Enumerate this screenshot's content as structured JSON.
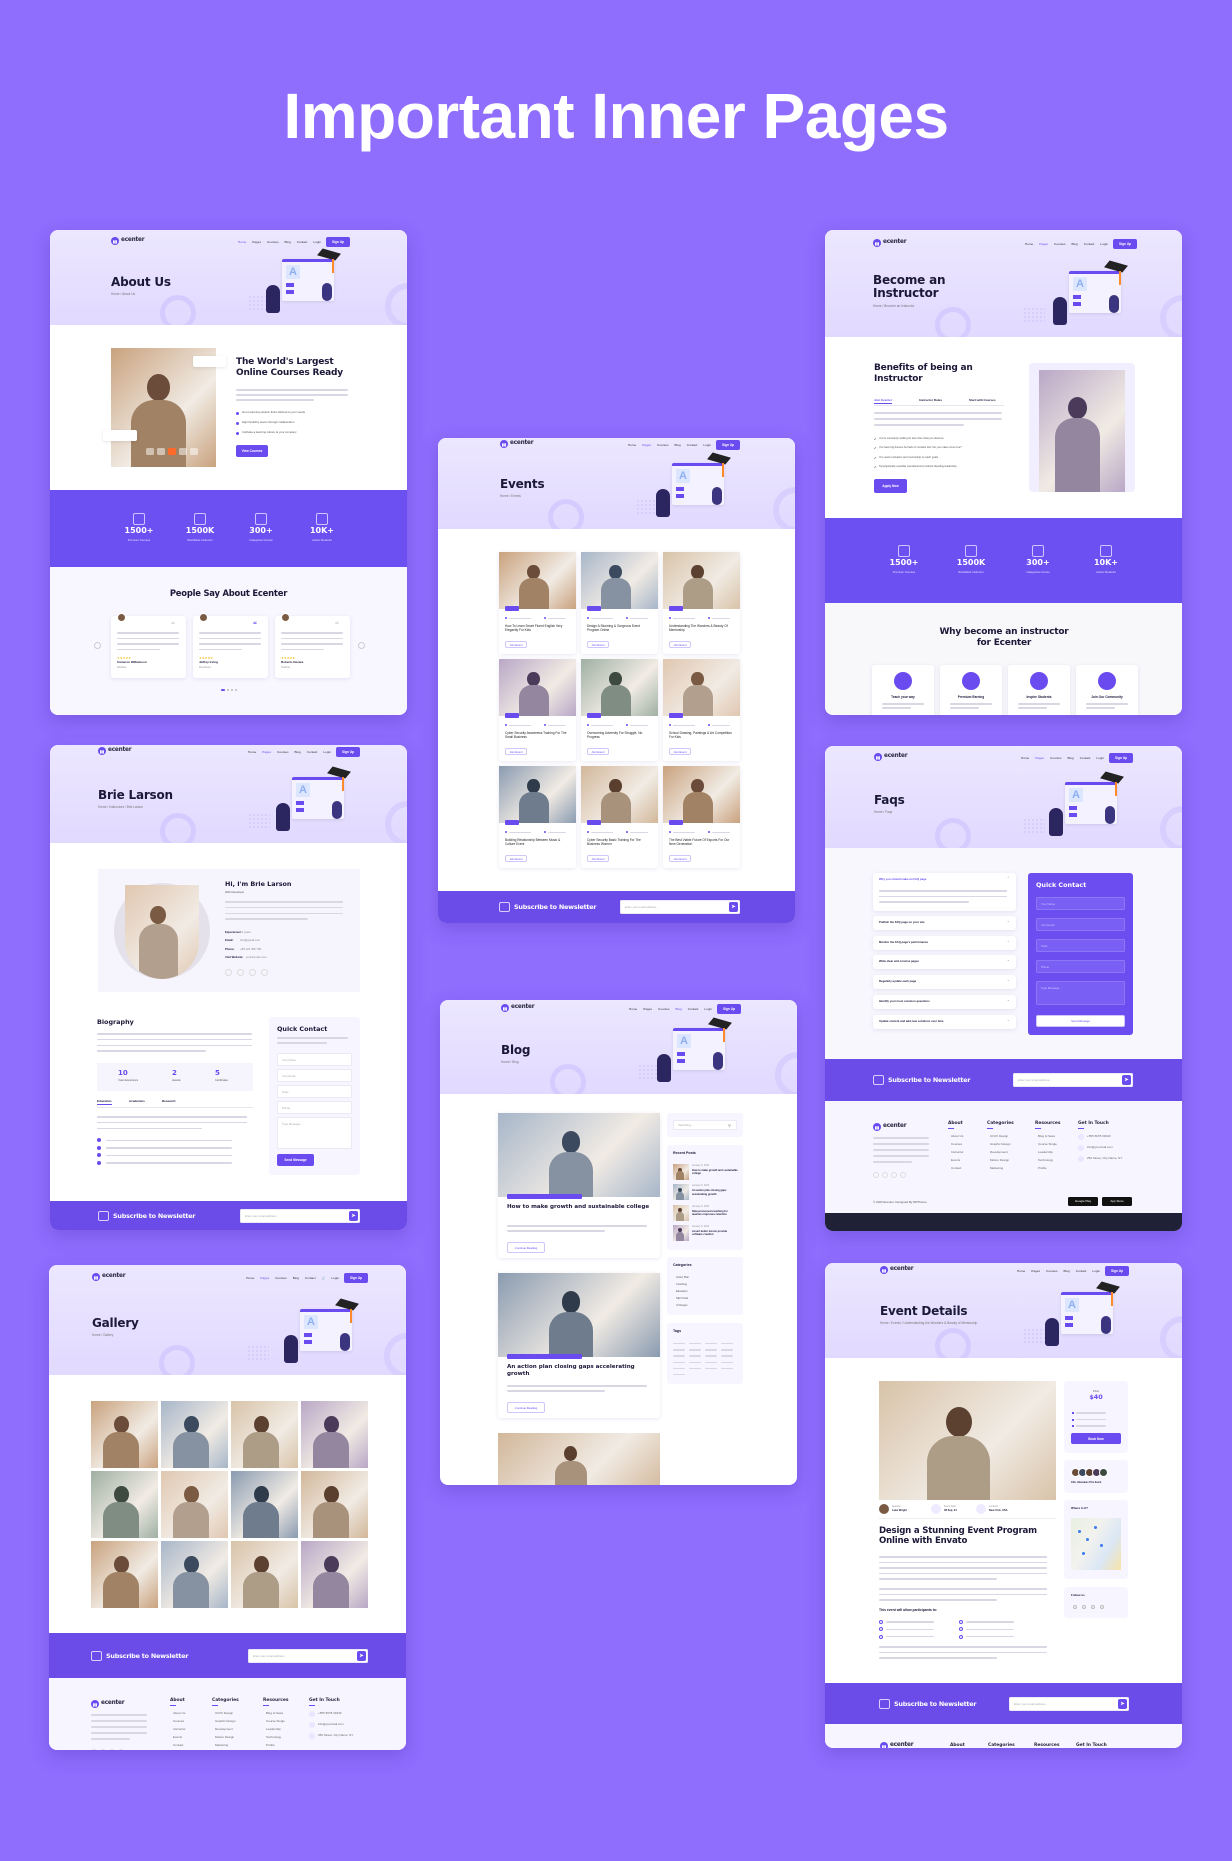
{
  "headline": "Important Inner Pages",
  "colors": {
    "background": "#8f6dfd",
    "primary": "#6a4bf0",
    "hero": "#e6e0ff",
    "dark_footer": "#1f2236",
    "accent_orange": "#ff6a2b"
  },
  "brand": {
    "name": "ecenter",
    "logo_icon": "book-icon"
  },
  "nav": {
    "items": [
      "Home",
      "Pages",
      "Courses",
      "Blog",
      "Contact"
    ],
    "login": "Login",
    "signup": "Sign Up"
  },
  "newsletter": {
    "title": "Subscribe to Newsletter",
    "placeholder": "Enter your email address...",
    "icon": "envelope-icon",
    "send_icon": "send-icon"
  },
  "stats": [
    {
      "value": "1500+",
      "label": "Premium Courses",
      "icon": "courses-icon"
    },
    {
      "value": "1500K",
      "label": "Worldwide Instructor",
      "icon": "instructor-icon"
    },
    {
      "value": "300+",
      "label": "Categories Course",
      "icon": "list-icon"
    },
    {
      "value": "10K+",
      "label": "Active Students",
      "icon": "user-icon"
    }
  ],
  "footer": {
    "columns": [
      {
        "title": "About",
        "items": [
          "About Us",
          "Courses",
          "Instructor",
          "Events",
          "Contact"
        ]
      },
      {
        "title": "Categories",
        "items": [
          "UI/UX Design",
          "Graphic Design",
          "Development",
          "Motion Design",
          "Marketing"
        ]
      },
      {
        "title": "Resources",
        "items": [
          "Blog & News",
          "Course Single",
          "Leadership",
          "Technology",
          "Profile"
        ]
      },
      {
        "title": "Get In Touch",
        "items": [
          "+555 5678 33340",
          "info@yourmail.com",
          "256 Street, City Name, NY"
        ]
      }
    ],
    "copyright": "© 2023 Ecenter. Designed By RRTheme",
    "apps": [
      "Google Play",
      "App Store"
    ]
  },
  "pages": {
    "about": {
      "title": "About Us",
      "crumb": "Home / About Us",
      "heading": "The World's Largest Online Courses Ready",
      "checks": [
        "Get a learning solution that's tailored to your needs",
        "High flexibility teams through collaboration",
        "Cultivate a learning culture at your company"
      ],
      "button": "View Courses",
      "testimonials_title": "People Say About Ecenter",
      "testimonials": [
        {
          "name": "Cameron Williamson",
          "role": "Website"
        },
        {
          "name": "Jeffrey Irving",
          "role": "Developer"
        },
        {
          "name": "Roberto Devara",
          "role": "Teacher"
        }
      ]
    },
    "instructor": {
      "title": "Become an Instructor",
      "crumb": "Home / Become an Instructor",
      "heading": "Benefits of being an Instructor",
      "tabs": [
        "Join Ecenter",
        "Instructor Rules",
        "Start with Courses"
      ],
      "checks": [
        "You're constantly settling for less than what you deserve.",
        "You have big dreams but lack of contacts don't let you make come true?",
        "You need motivation and mentorship to reach goals",
        "Synergistically expedite manufactured products bleeding leadership."
      ],
      "button": "Apply Now",
      "why_title": "Why become an instructor for Ecenter",
      "features": [
        "Teach your way",
        "Premium Earning",
        "Inspire Students",
        "Join Our Community"
      ]
    },
    "events": {
      "title": "Events",
      "crumb": "Home / Events",
      "button": "Join Event",
      "items": [
        "How To Learn Smart Fluent English Very Elegantly For Kids",
        "Design A Stunning & Gorgeous Event Program Online",
        "Understanding The Wonders & Beauty Of Mentorship",
        "Cyber Security Awareness Training For The Small Business",
        "Overcoming Adversity For Struggle, No Progress",
        "School Drawing, Paintings & Art Competition For Kids",
        "Building Relationship Between Music & Culture Event",
        "Cyber Security Basic Training For The Business Women",
        "The Best Viable Future Of Esports For Our Next Generation"
      ]
    },
    "instructor_profile": {
      "title": "Brie Larson",
      "crumb": "Home / Instructors / Brie Larson",
      "greeting": "Hi, I'm Brie Larson",
      "role": "Web Developer",
      "info": [
        {
          "label": "Experience:",
          "value": "10 years"
        },
        {
          "label": "Email:",
          "value": "info@gmail.com"
        },
        {
          "label": "Phone:",
          "value": "+88 123 456 789"
        },
        {
          "label": "Visit Website:",
          "value": "yourdomain.com"
        }
      ],
      "bio_title": "Biography",
      "counters": [
        {
          "value": "10",
          "label": "Years Experience"
        },
        {
          "value": "2",
          "label": "Awards"
        },
        {
          "value": "5",
          "label": "Certificates"
        }
      ],
      "tabs": [
        "Education",
        "Academics",
        "Research"
      ],
      "contact_title": "Quick Contact",
      "contact_fields": [
        "Your Name",
        "Your Email",
        "Topic",
        "Phone",
        "Type Message..."
      ],
      "contact_button": "Send Message"
    },
    "faqs": {
      "title": "Faqs",
      "crumb": "Home / Faqs",
      "questions": [
        "Why you should make an FAQ page",
        "Publish the FAQ page on your site",
        "Monitor the FAQ page's performance",
        "Write clear and concise pages",
        "Regularly update each page",
        "Identify your most common questions",
        "Update content and add new solutions over time"
      ],
      "contact_title": "Quick Contact",
      "contact_fields": [
        "Your Name",
        "Your Email",
        "Topic",
        "Phone",
        "Type Message..."
      ],
      "contact_button": "Send Message"
    },
    "blog": {
      "title": "Blog",
      "crumb": "Home / Blog",
      "posts": [
        {
          "title": "How to make growth and sustainable college"
        },
        {
          "title": "An action plan closing gaps accelerating growth"
        }
      ],
      "read_more": "Continue Reading",
      "search_placeholder": "Searching...",
      "recent_title": "Recent Posts",
      "recent": [
        "How to make growth and sustainable college",
        "An action plan closing gaps accelerating growth",
        "Data-processed coaching for teachers improves retention",
        "Assert better lesson provide software creation"
      ],
      "recent_date": "January 9, 2023",
      "categories_title": "Categories",
      "categories": [
        "Action Plan",
        "Coaching",
        "Education",
        "SEO Tools",
        "UI Design"
      ],
      "tags_title": "Tags"
    },
    "gallery": {
      "title": "Gallery",
      "crumb": "Home / Gallery"
    },
    "event_details": {
      "title": "Event Details",
      "crumb": "Home / Events / Understanding the Wonders & Beauty of Mentorship",
      "meta": [
        {
          "label": "Speaker",
          "value": "Luke Wright"
        },
        {
          "label": "Event Date",
          "value": "08 Sep, 24"
        },
        {
          "label": "Location",
          "value": "New York, USA"
        }
      ],
      "heading": "Design a Stunning Event Program Online with Envato",
      "list_title": "This event will allow participants to:",
      "price_label": "Price",
      "price": "$40",
      "book": "Book Now",
      "attendees": "100+ Attendees This Event",
      "where": "Where Is It?",
      "follow": "Follow us"
    }
  }
}
